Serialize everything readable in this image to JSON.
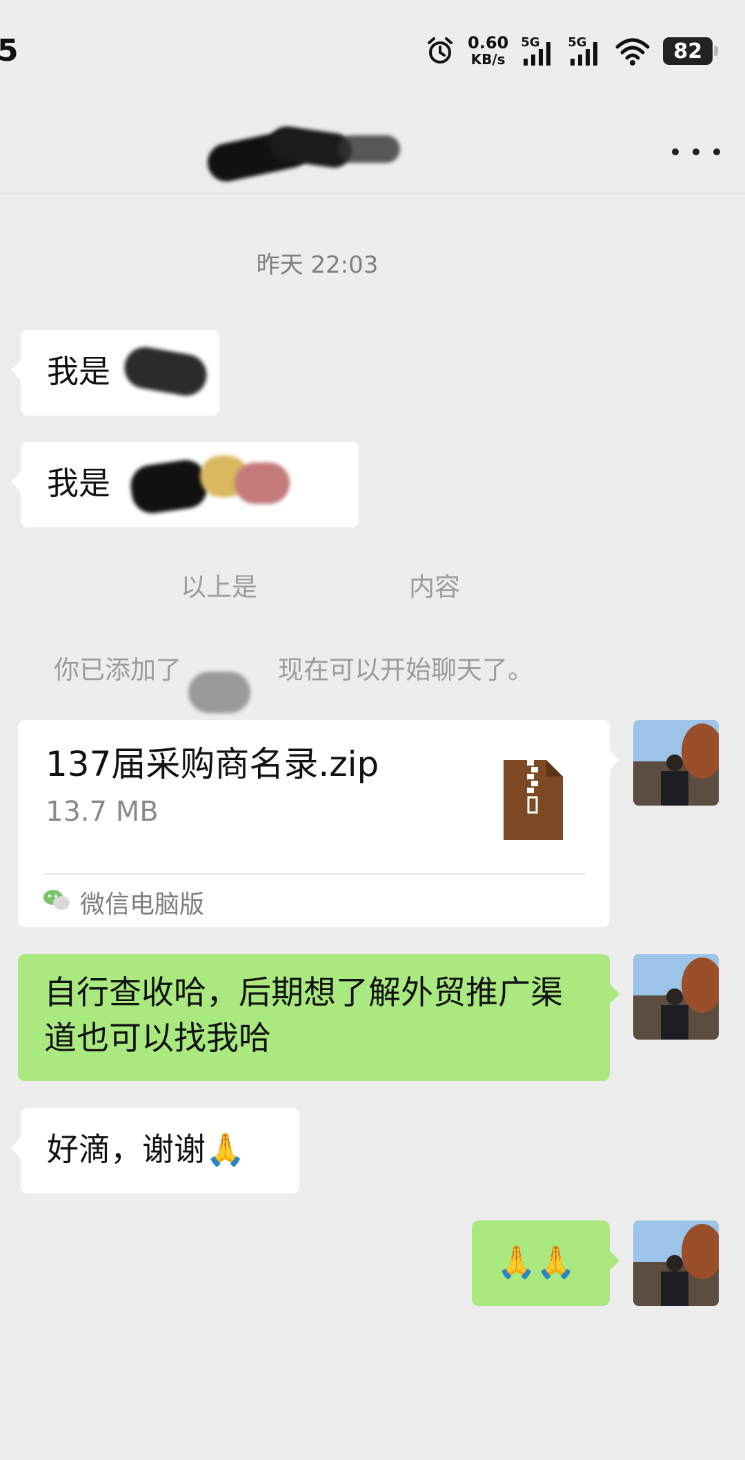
{
  "status_bar": {
    "time": "5",
    "net_speed_value": "0.60",
    "net_speed_unit": "KB/s",
    "sim1": "5G",
    "sim2": "5G",
    "battery": "82"
  },
  "chat": {
    "timestamp": "昨天 22:03",
    "messages": [
      {
        "side": "in",
        "text": "我是"
      },
      {
        "side": "in",
        "text": "我是"
      },
      {
        "side": "system",
        "text_left": "以上是",
        "text_right": "内容"
      },
      {
        "side": "system",
        "text_left": "你已添加了",
        "text_right": "现在可以开始聊天了。"
      }
    ],
    "file": {
      "name": "137届采购商名录.zip",
      "size": "13.7 MB",
      "source": "微信电脑版"
    },
    "text_out": "自行查收哈，后期想了解外贸推广渠道也可以找我哈",
    "reply_in": "好滴，谢谢🙏",
    "reply_out": "🙏🙏"
  },
  "colors": {
    "background": "#ededed",
    "out_bubble": "#a9e97f",
    "in_bubble": "#ffffff",
    "zip_icon": "#7d4a25"
  }
}
